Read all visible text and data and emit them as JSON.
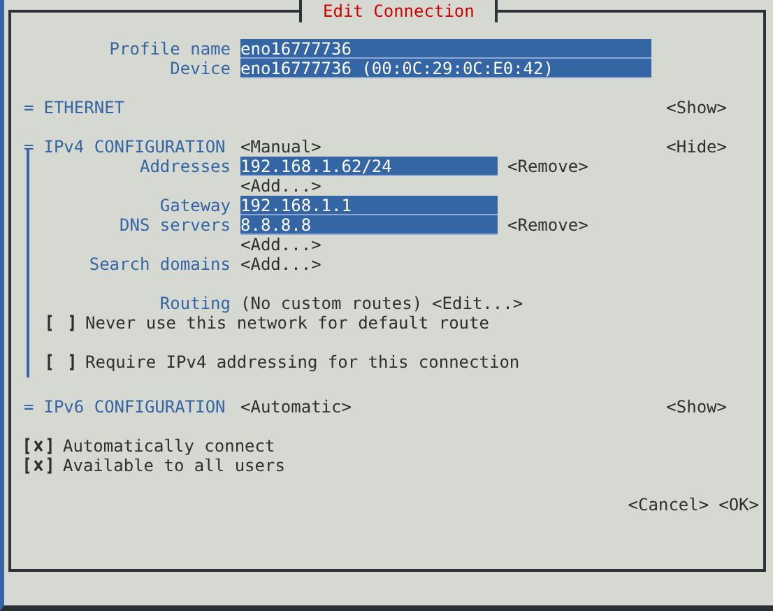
{
  "window": {
    "title": "Edit Connection"
  },
  "profile": [
    {
      "label": "Profile name",
      "value": "eno16777736"
    },
    {
      "label": "Device",
      "value": "eno16777736 (00:0C:29:0C:E0:42)"
    }
  ],
  "sections": [
    {
      "marker": "=",
      "title": "ETHERNET",
      "toggle": "<Show>",
      "expanded": false
    },
    {
      "marker": "=",
      "title": "IPv4 CONFIGURATION",
      "mode": "<Manual>",
      "toggle": "<Hide>",
      "expanded": true,
      "items": [
        {
          "kind": "list",
          "label": "Addresses",
          "entries": [
            {
              "value": "192.168.1.62/24",
              "remove": "<Remove>"
            }
          ],
          "add": "<Add...>"
        },
        {
          "kind": "field",
          "label": "Gateway",
          "value": "192.168.1.1"
        },
        {
          "kind": "list",
          "label": "DNS servers",
          "entries": [
            {
              "value": "8.8.8.8",
              "remove": "<Remove>"
            }
          ],
          "add": "<Add...>"
        },
        {
          "kind": "list",
          "label": "Search domains",
          "add": "<Add...>"
        },
        {
          "kind": "routing",
          "label": "Routing",
          "value": "(No custom routes)",
          "button": "<Edit...>"
        },
        {
          "kind": "checkbox",
          "label": "Never use this network for default route",
          "checked": false
        },
        {
          "kind": "checkbox",
          "label": "Require IPv4 addressing for this connection",
          "checked": false
        }
      ]
    },
    {
      "marker": "=",
      "title": "IPv6 CONFIGURATION",
      "mode": "<Automatic>",
      "toggle": "<Show>",
      "expanded": false
    }
  ],
  "options": [
    {
      "label": "Automatically connect",
      "checked": true
    },
    {
      "label": "Available to all users",
      "checked": true
    }
  ],
  "buttons": [
    "<Cancel>",
    "<OK>"
  ]
}
